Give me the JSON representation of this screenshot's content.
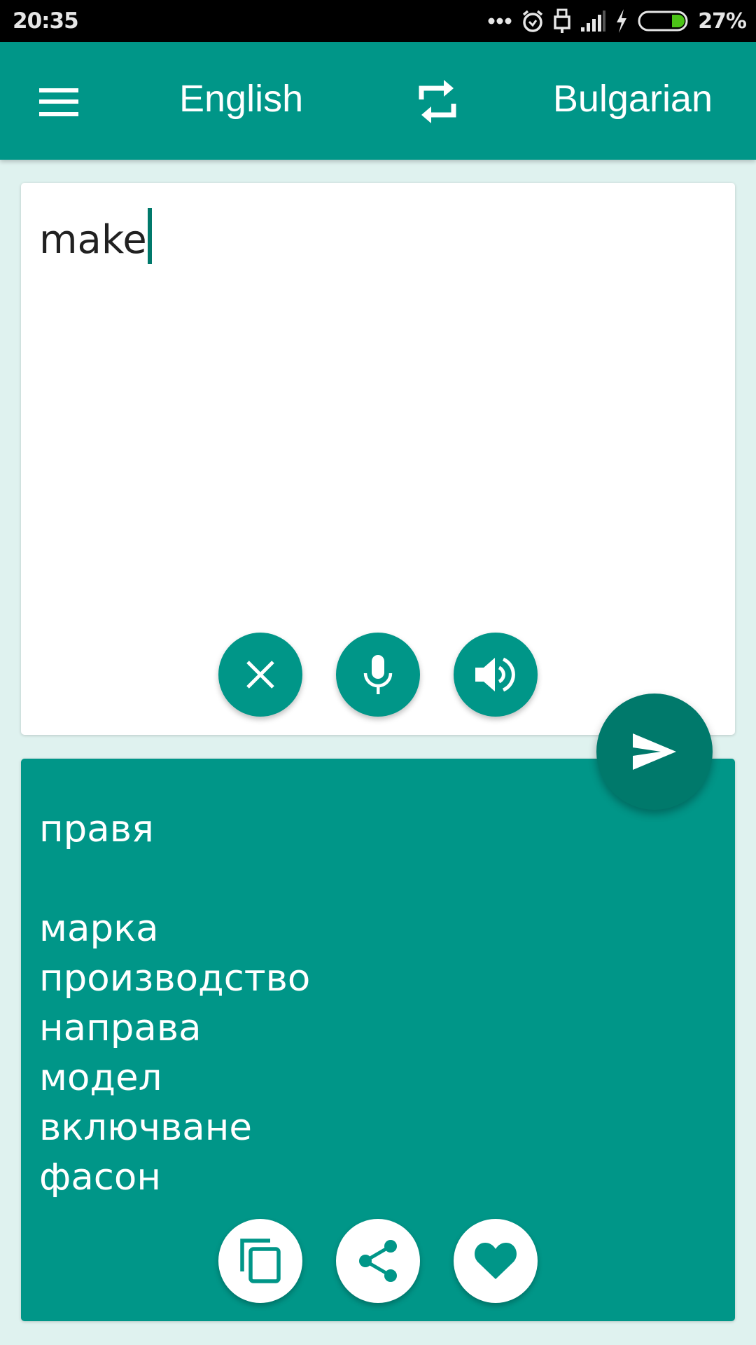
{
  "status_bar": {
    "time": "20:35",
    "icons": [
      "more-dots-icon",
      "alarm-icon",
      "usb-icon",
      "signal-icon",
      "charging-icon",
      "battery-icon"
    ],
    "battery_percent": "27%",
    "battery_level": 0.27,
    "battery_color": "#4cc417"
  },
  "toolbar": {
    "menu_icon": "hamburger-menu-icon",
    "source_language": "English",
    "swap_icon": "swap-languages-icon",
    "target_language": "Bulgarian",
    "background_color": "#009688"
  },
  "input": {
    "text": "make",
    "actions": [
      {
        "name": "clear",
        "icon": "close-icon"
      },
      {
        "name": "voice-input",
        "icon": "microphone-icon"
      },
      {
        "name": "speak",
        "icon": "speaker-icon"
      }
    ]
  },
  "translate_button": {
    "icon": "send-icon",
    "color": "#00796b"
  },
  "output": {
    "primary": "правя",
    "alternatives": [
      "марка",
      "производство",
      "направа",
      "модел",
      "включване",
      "фасон"
    ],
    "actions": [
      {
        "name": "copy",
        "icon": "copy-icon"
      },
      {
        "name": "share",
        "icon": "share-icon"
      },
      {
        "name": "favorite",
        "icon": "heart-icon"
      }
    ]
  },
  "colors": {
    "primary": "#009688",
    "primary_dark": "#00796b",
    "background": "#dff2ef"
  }
}
